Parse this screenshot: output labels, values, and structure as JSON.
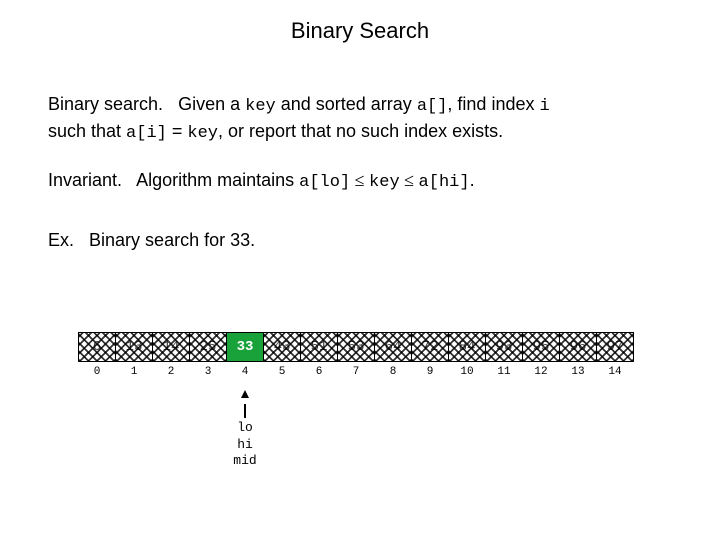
{
  "title": "Binary Search",
  "p1": {
    "lead": "Binary search.",
    "t1": "Given a ",
    "c1": "key",
    "t2": " and sorted array ",
    "c2": "a[]",
    "t3": ", find index ",
    "c3": "i",
    "t4": " such that ",
    "c4": "a[i]",
    "t5": " = ",
    "c5": "key",
    "t6": ", or report that no such index exists."
  },
  "p2": {
    "lead": "Invariant.",
    "t1": "Algorithm maintains ",
    "c1": "a[lo]",
    "le1": " ≤ ",
    "c2": "key",
    "le2": " ≤ ",
    "c3": "a[hi]",
    "t2": "."
  },
  "p3": {
    "lead": "Ex.",
    "t1": "Binary search for 33."
  },
  "array": {
    "values": [
      "6",
      "13",
      "14",
      "25",
      "33",
      "43",
      "51",
      "53",
      "64",
      "72",
      "84",
      "93",
      "95",
      "96",
      "97"
    ],
    "indices": [
      "0",
      "1",
      "2",
      "3",
      "4",
      "5",
      "6",
      "7",
      "8",
      "9",
      "10",
      "11",
      "12",
      "13",
      "14"
    ],
    "highlight_index": 4,
    "pointer_index": 4,
    "pointer_labels": [
      "lo",
      "hi",
      "mid"
    ]
  }
}
